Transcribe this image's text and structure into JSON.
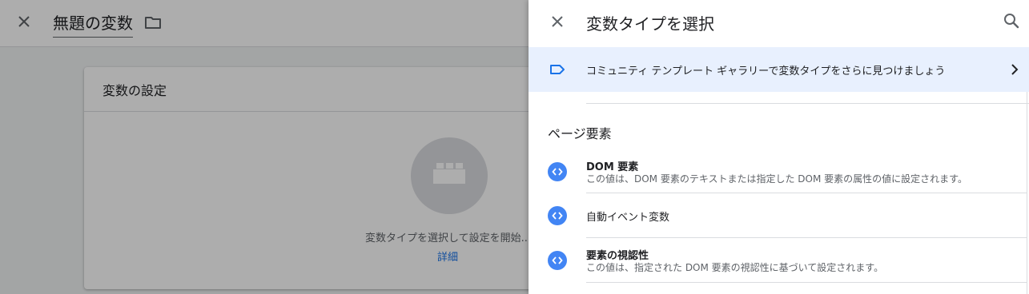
{
  "background": {
    "title": "無題の変数",
    "card_title": "変数の設定",
    "hint": "変数タイプを選択して設定を開始...",
    "link": "詳細"
  },
  "panel": {
    "title": "変数タイプを選択",
    "banner_text": "コミュニティ テンプレート ギャラリーで変数タイプをさらに見つけましょう",
    "section_title": "ページ要素",
    "items": [
      {
        "name": "DOM 要素",
        "description": "この値は、DOM 要素のテキストまたは指定した DOM 要素の属性の値に設定されます。"
      },
      {
        "name": "自動イベント変数",
        "description": ""
      },
      {
        "name": "要素の視認性",
        "description": "この値は、指定された DOM 要素の視認性に基づいて設定されます。"
      }
    ]
  },
  "icons": {
    "bg_close": "close-icon",
    "folder": "folder-icon",
    "variable_placeholder": "lego-block-icon",
    "panel_close": "close-icon",
    "search": "search-icon",
    "banner": "label-tag-icon",
    "chevron": "chevron-right-icon",
    "variable_type": "code-brackets-icon"
  },
  "colors": {
    "accent": "#1a73e8",
    "banner_bg": "#e8f0fe",
    "variable_icon": "#4285f4"
  }
}
